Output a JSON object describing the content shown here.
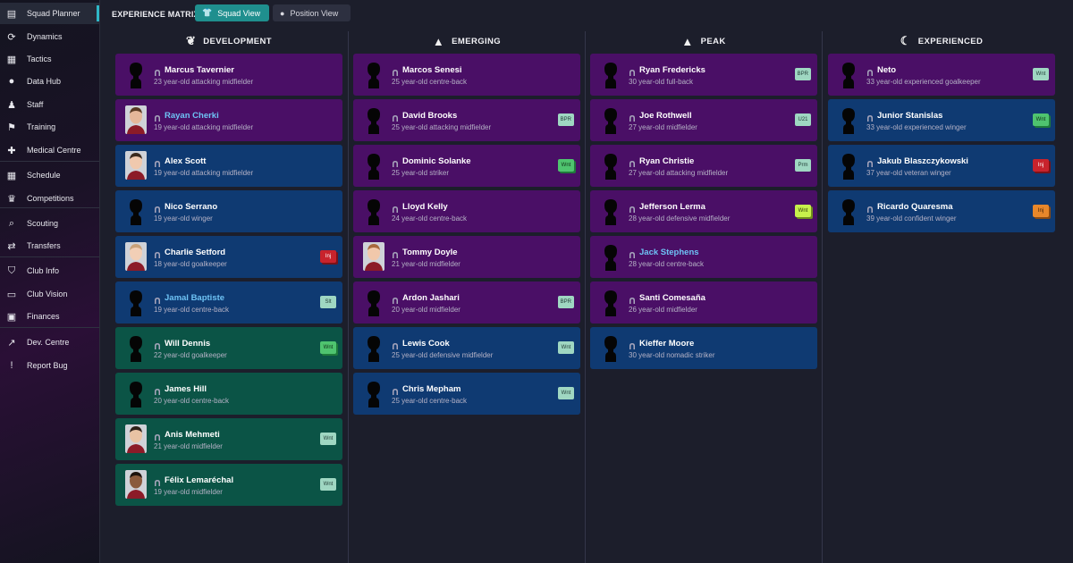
{
  "sidebar": {
    "items": [
      {
        "label": "Squad Planner",
        "icon": "clipboard-icon",
        "glyph": "▤",
        "active": true
      },
      {
        "label": "Dynamics",
        "icon": "dynamics-icon",
        "glyph": "⟳"
      },
      {
        "label": "Tactics",
        "icon": "tactics-board-icon",
        "glyph": "▦"
      },
      {
        "label": "Data Hub",
        "icon": "data-hub-icon",
        "glyph": "●"
      },
      {
        "label": "Staff",
        "icon": "staff-icon",
        "glyph": "♟"
      },
      {
        "label": "Training",
        "icon": "training-icon",
        "glyph": "⚑"
      },
      {
        "label": "Medical Centre",
        "icon": "medical-icon",
        "glyph": "✚"
      },
      {
        "label": "Schedule",
        "icon": "calendar-icon",
        "glyph": "▦"
      },
      {
        "label": "Competitions",
        "icon": "trophy-icon",
        "glyph": "♛"
      },
      {
        "label": "Scouting",
        "icon": "search-icon",
        "glyph": "⌕"
      },
      {
        "label": "Transfers",
        "icon": "transfers-icon",
        "glyph": "⇄"
      },
      {
        "label": "Club Info",
        "icon": "shield-icon",
        "glyph": "⛉"
      },
      {
        "label": "Club Vision",
        "icon": "club-vision-icon",
        "glyph": "▭"
      },
      {
        "label": "Finances",
        "icon": "finances-icon",
        "glyph": "▣"
      },
      {
        "label": "Dev. Centre",
        "icon": "dev-centre-icon",
        "glyph": "↗"
      },
      {
        "label": "Report Bug",
        "icon": "report-bug-icon",
        "glyph": "!"
      }
    ]
  },
  "header": {
    "title": "EXPERIENCE MATRIX",
    "squad_view": "Squad View",
    "position_view": "Position View"
  },
  "columns": [
    {
      "title": "DEVELOPMENT",
      "icon": "sprout-icon",
      "glyph": "❦",
      "players": [
        {
          "name": "Marcus Tavernier",
          "desc": "23 year-old attacking midfielder",
          "color": "purple",
          "badge": "",
          "photo": false,
          "hl": false
        },
        {
          "name": "Rayan Cherki",
          "desc": "19 year-old attacking midfielder",
          "color": "purple",
          "badge": "",
          "photo": true,
          "hl": true
        },
        {
          "name": "Alex Scott",
          "desc": "19 year-old attacking midfielder",
          "color": "blue",
          "badge": "",
          "photo": true,
          "hl": false
        },
        {
          "name": "Nico Serrano",
          "desc": "19 year-old winger",
          "color": "blue",
          "badge": "",
          "photo": false,
          "hl": false
        },
        {
          "name": "Charlie Setford",
          "desc": "18 year-old goalkeeper",
          "color": "blue",
          "badge": "Inj",
          "badge_type": "red",
          "photo": true,
          "hl": false
        },
        {
          "name": "Jamal Baptiste",
          "desc": "19 year-old centre-back",
          "color": "blue",
          "badge": "Slt",
          "badge_type": "grey",
          "photo": false,
          "hl": true
        },
        {
          "name": "Will Dennis",
          "desc": "22 year-old goalkeeper",
          "color": "green",
          "badge": "Wnt",
          "badge_type": "green",
          "photo": false,
          "hl": false
        },
        {
          "name": "James Hill",
          "desc": "20 year-old centre-back",
          "color": "green",
          "badge": "",
          "photo": false,
          "hl": false
        },
        {
          "name": "Anis Mehmeti",
          "desc": "21 year-old midfielder",
          "color": "green",
          "badge": "Wnt",
          "badge_type": "grey",
          "photo": true,
          "hl": false
        },
        {
          "name": "Félix Lemaréchal",
          "desc": "19 year-old midfielder",
          "color": "green",
          "badge": "Wnt",
          "badge_type": "grey",
          "photo": true,
          "hl": false
        }
      ]
    },
    {
      "title": "EMERGING",
      "icon": "rocket-icon",
      "glyph": "▲",
      "players": [
        {
          "name": "Marcos Senesi",
          "desc": "25 year-old centre-back",
          "color": "purple",
          "badge": "",
          "photo": false,
          "hl": false
        },
        {
          "name": "David Brooks",
          "desc": "25 year-old attacking midfielder",
          "color": "purple",
          "badge": "BPR",
          "badge_type": "grey",
          "photo": false,
          "hl": false
        },
        {
          "name": "Dominic Solanke",
          "desc": "25 year-old striker",
          "color": "purple",
          "badge": "Wnt",
          "badge_type": "green",
          "photo": false,
          "hl": false
        },
        {
          "name": "Lloyd Kelly",
          "desc": "24 year-old centre-back",
          "color": "purple",
          "badge": "",
          "photo": false,
          "hl": false
        },
        {
          "name": "Tommy Doyle",
          "desc": "21 year-old midfielder",
          "color": "purple",
          "badge": "",
          "photo": true,
          "hl": false
        },
        {
          "name": "Ardon Jashari",
          "desc": "20 year-old midfielder",
          "color": "purple",
          "badge": "BPR",
          "badge_type": "grey",
          "photo": false,
          "hl": false
        },
        {
          "name": "Lewis Cook",
          "desc": "25 year-old defensive midfielder",
          "color": "blue",
          "badge": "Wnt",
          "badge_type": "grey",
          "photo": false,
          "hl": false
        },
        {
          "name": "Chris Mepham",
          "desc": "25 year-old centre-back",
          "color": "blue",
          "badge": "Wnt",
          "badge_type": "grey",
          "photo": false,
          "hl": false
        }
      ]
    },
    {
      "title": "PEAK",
      "icon": "mountain-icon",
      "glyph": "▲",
      "players": [
        {
          "name": "Ryan Fredericks",
          "desc": "30 year-old full-back",
          "color": "purple",
          "badge": "BPR",
          "badge_type": "grey",
          "photo": false,
          "hl": false
        },
        {
          "name": "Joe Rothwell",
          "desc": "27 year-old midfielder",
          "color": "purple",
          "badge": "U21",
          "badge_type": "grey",
          "photo": false,
          "hl": false
        },
        {
          "name": "Ryan Christie",
          "desc": "27 year-old attacking midfielder",
          "color": "purple",
          "badge": "Prm",
          "badge_type": "grey",
          "photo": false,
          "hl": false
        },
        {
          "name": "Jefferson Lerma",
          "desc": "28 year-old defensive midfielder",
          "color": "purple",
          "badge": "Wnt",
          "badge_type": "lime",
          "photo": false,
          "hl": false
        },
        {
          "name": "Jack Stephens",
          "desc": "28 year-old centre-back",
          "color": "purple",
          "badge": "",
          "photo": false,
          "hl": true
        },
        {
          "name": "Santi Comesaña",
          "desc": "26 year-old midfielder",
          "color": "purple",
          "badge": "",
          "photo": false,
          "hl": false
        },
        {
          "name": "Kieffer Moore",
          "desc": "30 year-old nomadic striker",
          "color": "blue",
          "badge": "",
          "photo": false,
          "hl": false
        }
      ]
    },
    {
      "title": "EXPERIENCED",
      "icon": "moon-icon",
      "glyph": "☾",
      "players": [
        {
          "name": "Neto",
          "desc": "33 year-old experienced goalkeeper",
          "color": "purple",
          "badge": "Wnt",
          "badge_type": "grey",
          "photo": false,
          "hl": false
        },
        {
          "name": "Junior Stanislas",
          "desc": "33 year-old experienced winger",
          "color": "blue",
          "badge": "Wnt",
          "badge_type": "green",
          "photo": false,
          "hl": false
        },
        {
          "name": "Jakub Blaszczykowski",
          "desc": "37 year-old veteran winger",
          "color": "blue",
          "badge": "Inj",
          "badge_type": "red",
          "photo": false,
          "hl": false
        },
        {
          "name": "Ricardo Quaresma",
          "desc": "39 year-old confident winger",
          "color": "blue",
          "badge": "Inj",
          "badge_type": "orange",
          "photo": false,
          "hl": false
        }
      ]
    }
  ]
}
